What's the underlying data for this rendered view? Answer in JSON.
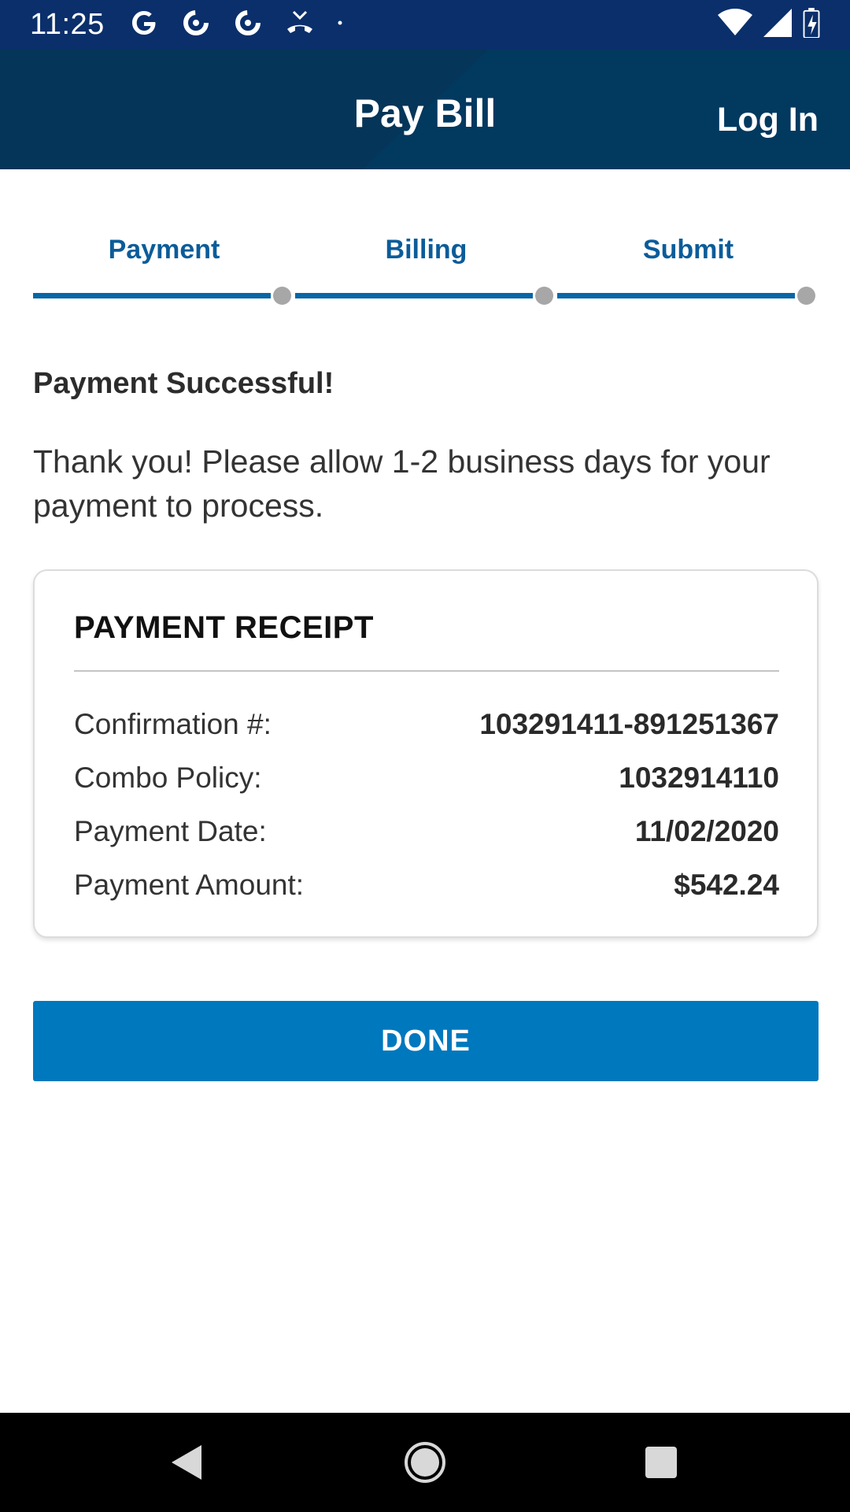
{
  "status_bar": {
    "time": "11:25",
    "left_icons": [
      "google-icon",
      "pocket-casts-icon",
      "pocket-casts-icon",
      "missed-call-icon",
      "dot-icon"
    ],
    "right_icons": [
      "wifi-icon",
      "signal-icon",
      "battery-icon"
    ]
  },
  "header": {
    "title": "Pay Bill",
    "login_label": "Log In",
    "colors": {
      "background": "#02395f",
      "status_bar": "#0a2f6b"
    }
  },
  "stepper": {
    "steps": [
      {
        "label": "Payment"
      },
      {
        "label": "Billing"
      },
      {
        "label": "Submit"
      }
    ],
    "progress": 1.0,
    "colors": {
      "active": "#0866a6",
      "dot": "#a7a7a7"
    }
  },
  "message": {
    "title": "Payment Successful!",
    "body": "Thank you! Please allow 1-2 business days for your payment to process."
  },
  "receipt": {
    "title": "PAYMENT RECEIPT",
    "rows": [
      {
        "label": "Confirmation #:",
        "value": "103291411-891251367"
      },
      {
        "label": "Combo Policy:",
        "value": "1032914110"
      },
      {
        "label": "Payment Date:",
        "value": "11/02/2020"
      },
      {
        "label": "Payment Amount:",
        "value": "$542.24"
      }
    ]
  },
  "actions": {
    "done_label": "DONE",
    "colors": {
      "primary": "#0078be"
    }
  },
  "nav_bar": {
    "buttons": [
      "back-icon",
      "home-icon",
      "recents-icon"
    ]
  }
}
